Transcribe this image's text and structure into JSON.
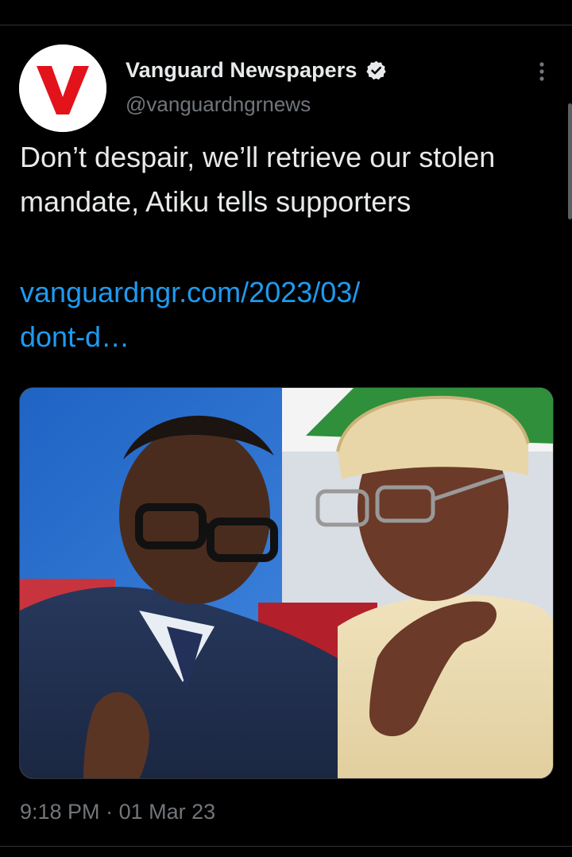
{
  "tweet": {
    "display_name": "Vanguard Newspapers",
    "handle": "@vanguardngrnews",
    "text": "Don’t despair, we’ll retrieve our stolen mandate, Atiku tells supporters",
    "link_line1": "vanguardngr.com/2023/03/",
    "link_line2": "dont-d…",
    "time": "9:18 PM",
    "separator": " · ",
    "date": "01 Mar 23"
  },
  "avatar": {
    "letter": "V",
    "letter_color": "#e3131b",
    "background": "#ffffff"
  },
  "icons": {
    "verified": "verified-badge-icon",
    "more": "more-vertical-icon"
  },
  "colors": {
    "background": "#000000",
    "text": "#e7e9ea",
    "secondary": "#71767b",
    "link": "#1d9bf0",
    "divider": "#2f3336"
  }
}
